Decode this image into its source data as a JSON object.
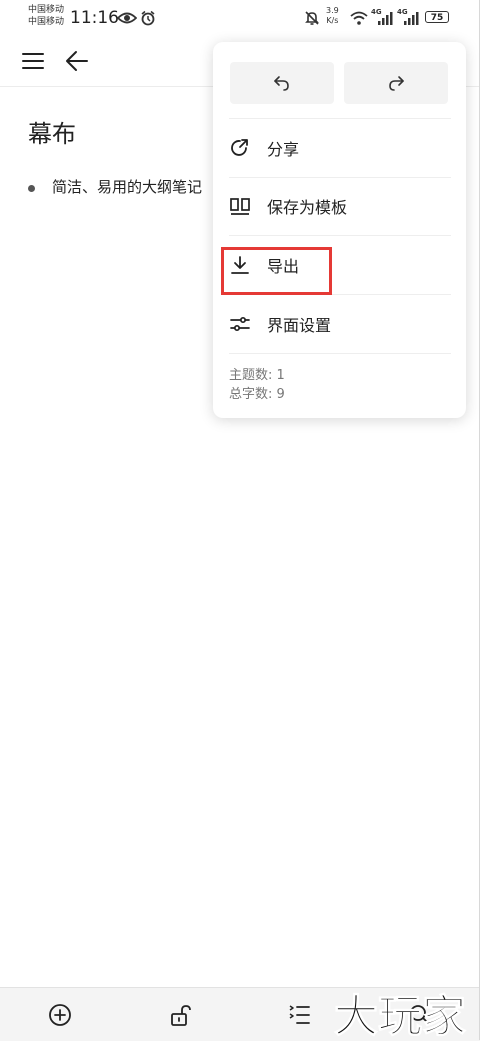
{
  "status_bar": {
    "carrier_1": "中国移动",
    "carrier_2": "中国移动",
    "time": "11:16",
    "speed_value": "3.9",
    "speed_unit": "K/s",
    "signal_1_label": "4G",
    "signal_2_label": "4G",
    "battery": "75"
  },
  "toolbar": {
    "menu_icon": "hamburger-menu-icon",
    "back_icon": "arrow-left-icon"
  },
  "document": {
    "title": "幕布",
    "items": [
      {
        "text": "简洁、易用的大纲笔记"
      }
    ]
  },
  "dropdown_menu": {
    "undo_icon": "undo-icon",
    "redo_icon": "redo-icon",
    "items": [
      {
        "label": "分享",
        "icon": "share-icon"
      },
      {
        "label": "保存为模板",
        "icon": "template-icon"
      },
      {
        "label": "导出",
        "icon": "download-icon",
        "highlighted": true
      },
      {
        "label": "界面设置",
        "icon": "sliders-icon"
      }
    ],
    "stats": {
      "topics": "主题数: 1",
      "words": "总字数: 9"
    }
  },
  "bottom_bar": {
    "items": [
      "add-circle-icon",
      "unlock-icon",
      "indent-list-icon",
      "search-icon"
    ]
  },
  "watermark": {
    "text": "大玩家"
  },
  "colors": {
    "highlight": "#e53935",
    "button_bg": "#f3f3f3",
    "secondary_text": "#777777"
  }
}
